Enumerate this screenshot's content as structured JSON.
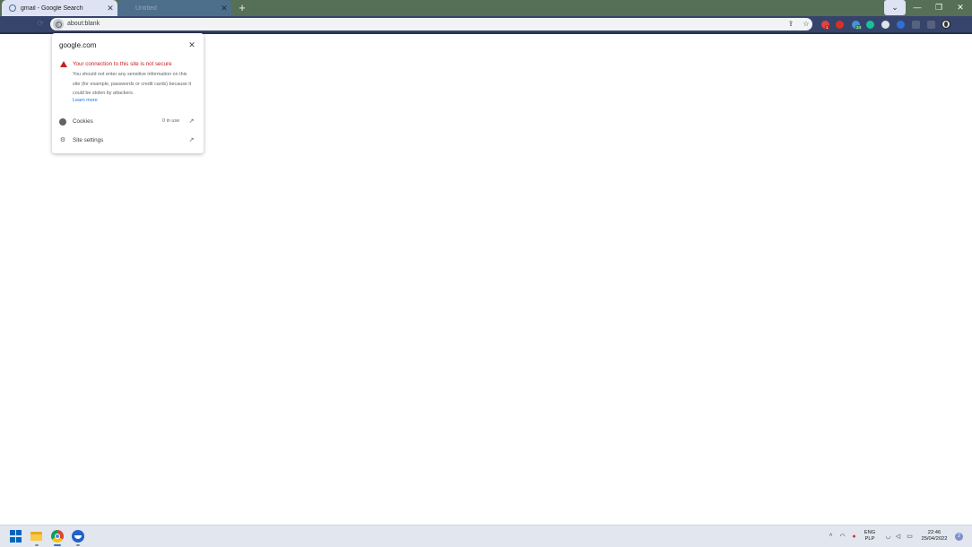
{
  "tabs": [
    {
      "title": "gmail - Google Search",
      "active": true
    },
    {
      "title": "Untitled",
      "active": false
    }
  ],
  "window_controls": {
    "dropdown": "⌄",
    "minimize": "—",
    "maximize": "❐",
    "close": "✕"
  },
  "new_tab_icon": "+",
  "address_bar": {
    "url": "about:blank"
  },
  "extensions": [
    {
      "name": "ext-red-badge",
      "color": "#e0443d",
      "badge": "1"
    },
    {
      "name": "ext-red-drop",
      "color": "#d93025",
      "badge": ""
    },
    {
      "name": "ext-blue-24",
      "color": "#4a90d9",
      "badge": "24"
    },
    {
      "name": "ext-grammarly",
      "color": "#15c39a",
      "badge": ""
    },
    {
      "name": "ext-white-shield",
      "color": "#dfe3ea",
      "badge": ""
    },
    {
      "name": "ext-blue-square",
      "color": "#2f6fd8",
      "badge": ""
    },
    {
      "name": "ext-puzzle",
      "color": "#56627e",
      "badge": ""
    },
    {
      "name": "ext-sidepanel",
      "color": "#56627e",
      "badge": ""
    }
  ],
  "site_info_popup": {
    "domain": "google.com",
    "close_icon": "✕",
    "warning_title": "Your connection to this site is not secure",
    "warning_body": "You should not enter any sensitive information on this site (for example, passwords or credit cards) because it could be stolen by attackers.",
    "learn_more": "Learn more",
    "rows": [
      {
        "label": "Cookies",
        "value": "0 in use",
        "icon": "cookie-icon"
      },
      {
        "label": "Site settings",
        "value": "",
        "icon": "gear-icon"
      }
    ]
  },
  "taskbar": {
    "apps": [
      "start-button",
      "file-explorer",
      "chrome",
      "app-blue-circle"
    ],
    "tray": {
      "language": "ENG",
      "layout": "PLP",
      "time": "22:46",
      "date": "25/04/2022",
      "notifications": "2"
    }
  },
  "colors": {
    "tabstrip": "#566f57",
    "toolbar": "#36446b",
    "warning": "#c5221f",
    "link": "#1a73e8",
    "taskbar": "#e1e6ef"
  }
}
